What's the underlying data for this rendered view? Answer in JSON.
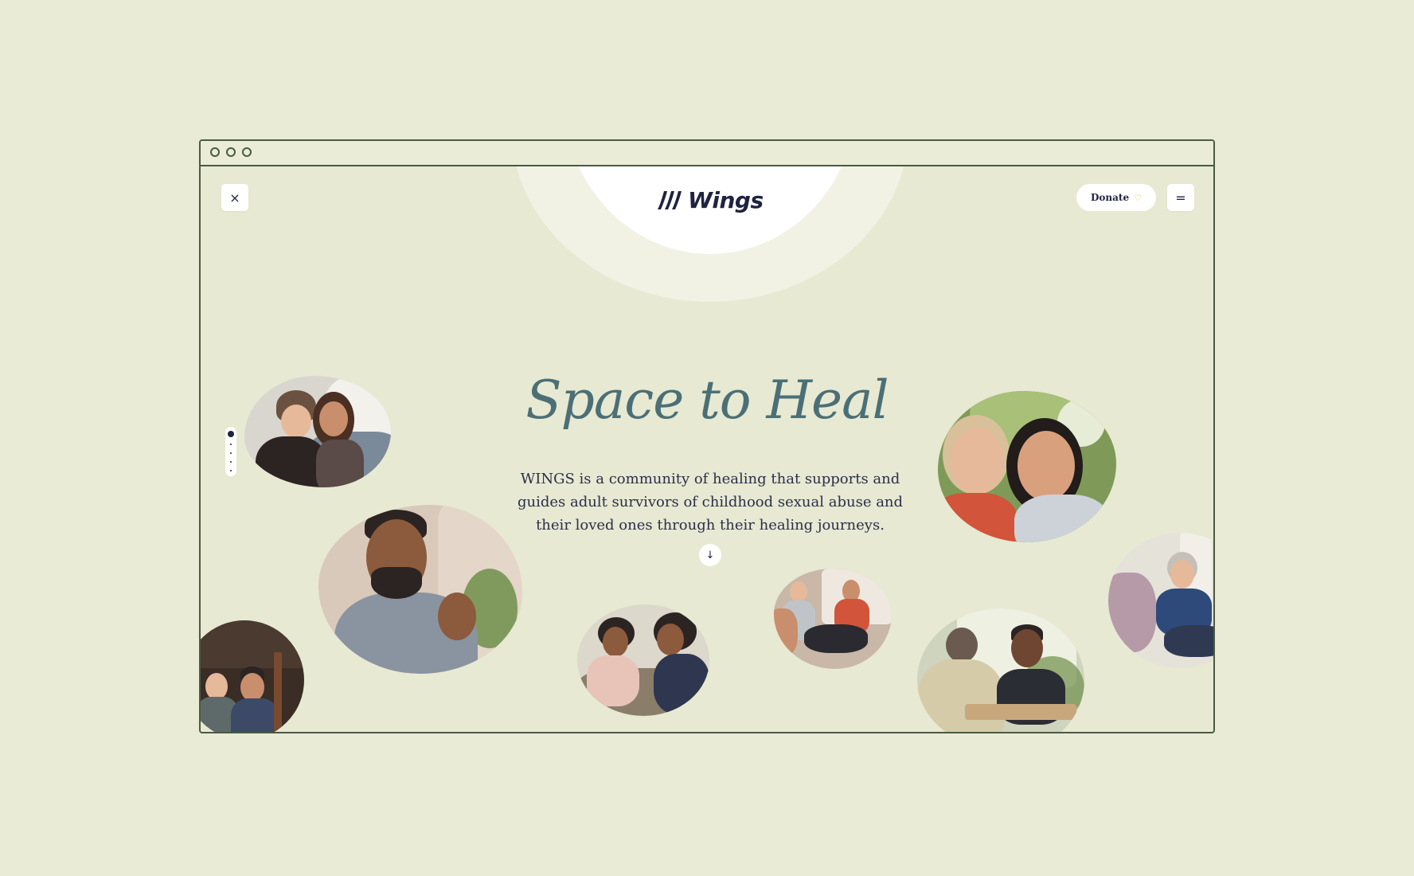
{
  "window": {
    "controls": [
      "window-dot",
      "window-dot",
      "window-dot"
    ]
  },
  "header": {
    "logo_text": "Wings",
    "close_icon": "×",
    "donate_label": "Donate",
    "donate_icon": "♡",
    "menu_icon": "="
  },
  "hero": {
    "title_part1": "Space to",
    "title_part2": "Heal",
    "description": "WINGS is a community of healing that supports and guides adult survivors of childhood sexual abuse and their loved ones through their healing journeys.",
    "scroll_icon": "↓"
  },
  "pager": {
    "total": 5,
    "active": 0
  },
  "colors": {
    "background": "#e9ebd6",
    "frame": "#4a5a43",
    "title": "#4b6f76",
    "highlight": "#eeb93d",
    "text": "#1f2340"
  },
  "photos": [
    "two-women-hugging-photo",
    "man-with-glasses-photo",
    "two-men-sitting-photo",
    "women-conversation-photo",
    "group-circle-photo",
    "two-women-smiling-photo",
    "two-men-talking-photo",
    "support-group-photo"
  ]
}
